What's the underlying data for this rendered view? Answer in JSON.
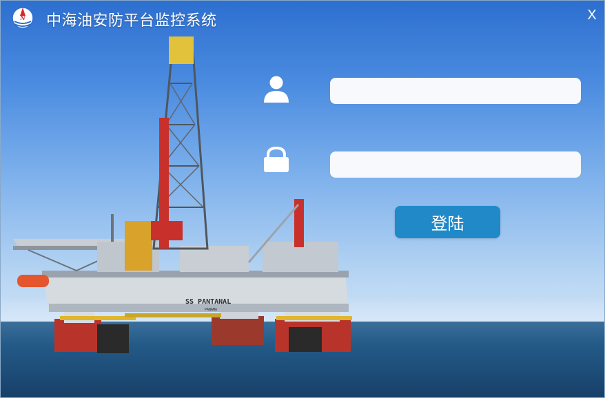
{
  "window": {
    "title": "中海油安防平台监控系统",
    "close_label": "X",
    "logo_icon": "cnooc-logo-icon"
  },
  "login": {
    "username_icon": "user-icon",
    "username_value": "",
    "password_icon": "lock-icon",
    "password_value": "",
    "submit_label": "登陆"
  },
  "scene": {
    "rig_name": "SS PANTANAL",
    "rig_flag": "PANAMA"
  },
  "colors": {
    "button": "#2189c8",
    "title_text": "#ffffff",
    "input_bg": "#f7f9fc"
  }
}
